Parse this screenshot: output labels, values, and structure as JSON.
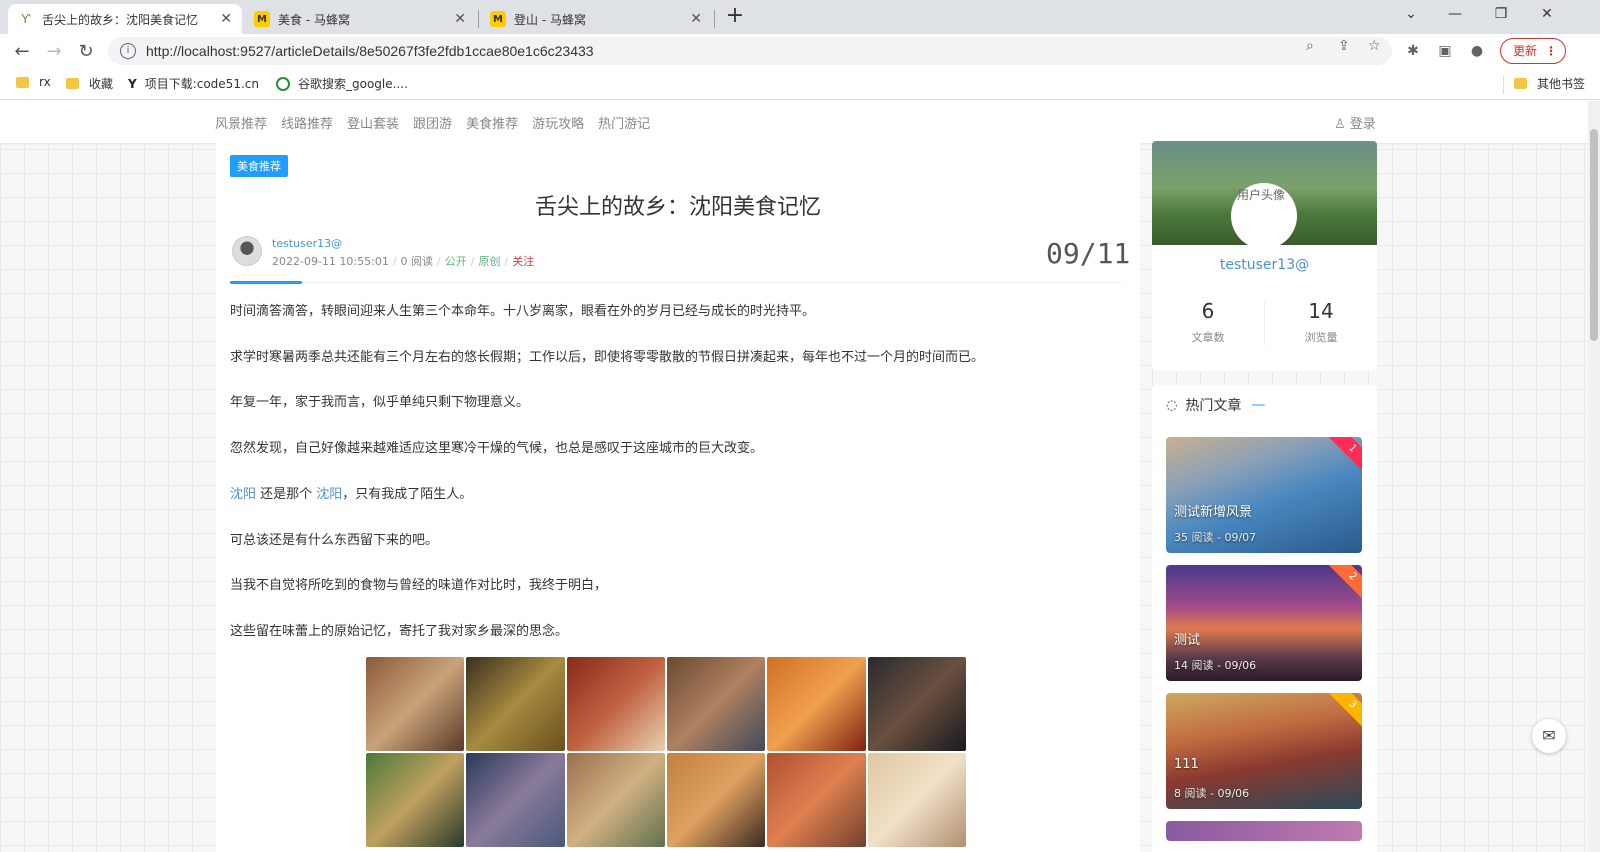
{
  "browser": {
    "tabs": [
      {
        "label": "舌尖上的故乡：沈阳美食记忆",
        "icon": "sprout-icon"
      },
      {
        "label": "美食 - 马蜂窝",
        "icon": "mafengwo-icon"
      },
      {
        "label": "登山 - 马蜂窝",
        "icon": "mafengwo-icon"
      }
    ],
    "url": "http://localhost:9527/articleDetails/8e50267f3fe2fdb1ccae80e1c6c23433",
    "update_label": "更新",
    "bookmarks": [
      "rx",
      "收藏",
      "项目下载:code51.cn",
      "谷歌搜索_google...."
    ],
    "other_bookmarks": "其他书签"
  },
  "site": {
    "menu": [
      "风景推荐",
      "线路推荐",
      "登山套装",
      "跟团游",
      "美食推荐",
      "游玩攻略",
      "热门游记"
    ],
    "login": "登录"
  },
  "article": {
    "category": "美食推荐",
    "title": "舌尖上的故乡：沈阳美食记忆",
    "author": "testuser13@",
    "datetime": "2022-09-11 10:55:01",
    "reads": "0 阅读",
    "visibility": "公开",
    "origin": "原创",
    "follow": "关注",
    "date_big": "09/11",
    "paragraphs": [
      "时间滴答滴答，转眼间迎来人生第三个本命年。十八岁离家，眼看在外的岁月已经与成长的时光持平。",
      "求学时寒暑两季总共还能有三个月左右的悠长假期；工作以后，即使将零零散散的节假日拼凑起来，每年也不过一个月的时间而已。",
      "年复一年，家于我而言，似乎单纯只剩下物理意义。",
      "忽然发现，自己好像越来越难适应这里寒冷干燥的气候，也总是感叹于这座城市的巨大改变。",
      "可总该还是有什么东西留下来的吧。",
      "当我不自觉将所吃到的食物与曾经的味道作对比时，我终于明白，",
      "这些留在味蕾上的原始记忆，寄托了我对家乡最深的思念。"
    ],
    "link_para": {
      "link1": "沈阳",
      "mid": " 还是那个 ",
      "link2": "沈阳",
      "end": "，只有我成了陌生人。"
    }
  },
  "profile": {
    "avatar_alt": "用户头像",
    "name": "testuser13@",
    "articles_count": "6",
    "articles_label": "文章数",
    "views_count": "14",
    "views_label": "浏览量"
  },
  "hot": {
    "title": "热门文章",
    "items": [
      {
        "title": "测试新增风景",
        "meta": "35 阅读 - 09/07",
        "rank": "1",
        "rank_color": "#ff2d55"
      },
      {
        "title": "测试",
        "meta": "14 阅读 - 09/06",
        "rank": "2",
        "rank_color": "#ff6b35"
      },
      {
        "title": "111",
        "meta": "8 阅读 - 09/06",
        "rank": "3",
        "rank_color": "#ffb400"
      }
    ]
  }
}
